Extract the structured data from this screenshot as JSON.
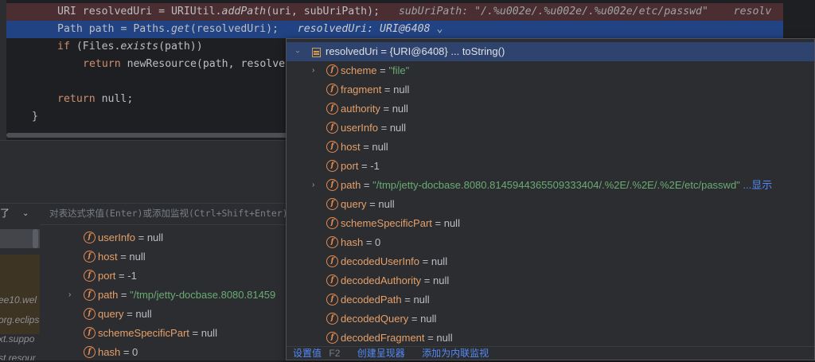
{
  "editor": {
    "line1": {
      "type": "URI",
      "var": "resolvedUri",
      "eq": "=",
      "cls": "URIUtil.",
      "method": "addPath",
      "args": "(uri, subUriPath);",
      "hint_name": "subUriPath:",
      "hint_value": "\"/.%u002e/.%u002e/.%u002e/etc/passwd\"",
      "hint_tail": "resolv"
    },
    "line2": {
      "type": "Path",
      "var": "path",
      "eq": "=",
      "cls": "Paths.",
      "method": "get",
      "args": "(resolvedUri);",
      "hint": "resolvedUri: URI@6408",
      "hint_chevron": "⌄"
    },
    "line3": {
      "kw": "if",
      "rest": "(Files.",
      "method": "exists",
      "rest2": "(path))"
    },
    "line4": {
      "kw": "return",
      "rest": "newResource(path, resolve"
    },
    "line5": {
      "kw": "return",
      "rest": "null;"
    },
    "line6": {
      "brace": "}"
    }
  },
  "debugger": {
    "dropdown_label": "了",
    "dropdown_chevron": "⌄",
    "eval_placeholder": "对表达式求值(Enter)或添加监视(Ctrl+Shift+Enter)",
    "frames": [
      "ee10.wel",
      "org.eclips",
      "xt.suppo",
      "st.resour"
    ],
    "vars": [
      {
        "name": "userInfo",
        "op": " = ",
        "value": "null"
      },
      {
        "name": "host",
        "op": " = ",
        "value": "null"
      },
      {
        "name": "port",
        "op": " = ",
        "value": "-1"
      },
      {
        "name": "path",
        "op": " = ",
        "value": "\"/tmp/jetty-docbase.8080.81459"
      },
      {
        "name": "query",
        "op": " = ",
        "value": "null"
      },
      {
        "name": "schemeSpecificPart",
        "op": " = ",
        "value": "null"
      },
      {
        "name": "hash",
        "op": " = ",
        "value": "0"
      }
    ]
  },
  "popup": {
    "root_name": "resolvedUri",
    "root_value": " = {URI@6408}  ... toString()",
    "fields": [
      {
        "name": "scheme",
        "op": " = ",
        "value": "\"file\"",
        "str": true
      },
      {
        "name": "fragment",
        "op": " = ",
        "value": "null"
      },
      {
        "name": "authority",
        "op": " = ",
        "value": "null"
      },
      {
        "name": "userInfo",
        "op": " = ",
        "value": "null"
      },
      {
        "name": "host",
        "op": " = ",
        "value": "null"
      },
      {
        "name": "port",
        "op": " = ",
        "value": "-1"
      },
      {
        "name": "path",
        "op": " = ",
        "value": "\"/tmp/jetty-docbase.8080.8145944365509333404/.%2E/.%2E/.%2E/etc/passwd\"",
        "str": true,
        "link": " ...显示"
      },
      {
        "name": "query",
        "op": " = ",
        "value": "null"
      },
      {
        "name": "schemeSpecificPart",
        "op": " = ",
        "value": "null"
      },
      {
        "name": "hash",
        "op": " = ",
        "value": "0"
      },
      {
        "name": "decodedUserInfo",
        "op": " = ",
        "value": "null"
      },
      {
        "name": "decodedAuthority",
        "op": " = ",
        "value": "null"
      },
      {
        "name": "decodedPath",
        "op": " = ",
        "value": "null"
      },
      {
        "name": "decodedQuery",
        "op": " = ",
        "value": "null"
      },
      {
        "name": "decodedFragment",
        "op": " = ",
        "value": "null"
      }
    ],
    "footer": {
      "set_value": "设置值",
      "set_value_key": "F2",
      "create_watch": "创建呈现器",
      "add_inline": "添加为内联监视"
    }
  },
  "icons": {
    "field": "f",
    "expand": "›"
  },
  "colors": {
    "accent": "#548af7",
    "field_icon": "#e58a51",
    "string": "#6aab73",
    "selection": "#214283"
  }
}
